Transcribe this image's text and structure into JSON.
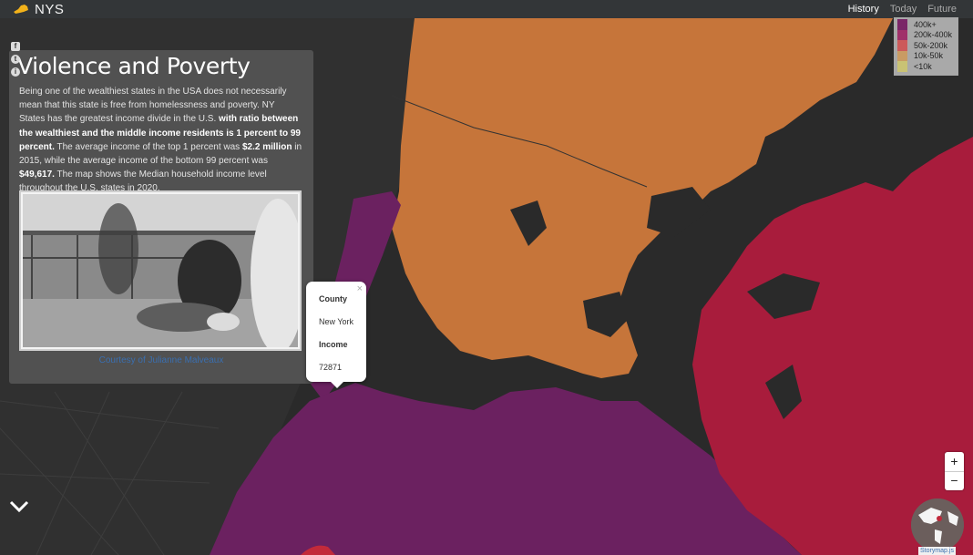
{
  "topbar": {
    "title": "NYS",
    "nav": [
      "History",
      "Today",
      "Future"
    ],
    "active": "History"
  },
  "legend": {
    "items": [
      {
        "label": "400k+",
        "color": "#7a2668"
      },
      {
        "label": "200k-400k",
        "color": "#a0306a"
      },
      {
        "label": "50k-200k",
        "color": "#cc5a5a"
      },
      {
        "label": "10k-50k",
        "color": "#c99b63"
      },
      {
        "label": "<10k",
        "color": "#c9c274"
      }
    ]
  },
  "social": {
    "icons": [
      "facebook-icon",
      "twitter-icon",
      "info-icon"
    ]
  },
  "panel": {
    "title": "Violence and Poverty",
    "text_1": "Being one of the wealthiest states in the USA does not necessarily mean that this state is free from homelessness and poverty. NY States has the greatest income divide in the U.S. ",
    "bold_1": "with ratio between the wealthiest and the middle income residents is 1 percent to 99 percent.",
    "text_2": " The average income of the top 1 percent was ",
    "bold_2": "$2.2 million",
    "text_3": " in 2015, while the average income of the bottom 99 percent was ",
    "bold_3": "$49,617.",
    "text_4": " The map shows the Median household income level throughout the U.S. states in 2020.",
    "caption": "Courtesy of Julianne Malveaux"
  },
  "popup": {
    "close": "×",
    "field1_label": "County",
    "field1_value": "New York",
    "field2_label": "Income",
    "field2_value": "72871"
  },
  "zoom": {
    "in": "+",
    "out": "−"
  },
  "attribution": "Storymap.js",
  "colors": {
    "water": "#2b2b2b",
    "orange": "#c6753a",
    "purple": "#6b2160",
    "crimson": "#a81c3c"
  }
}
